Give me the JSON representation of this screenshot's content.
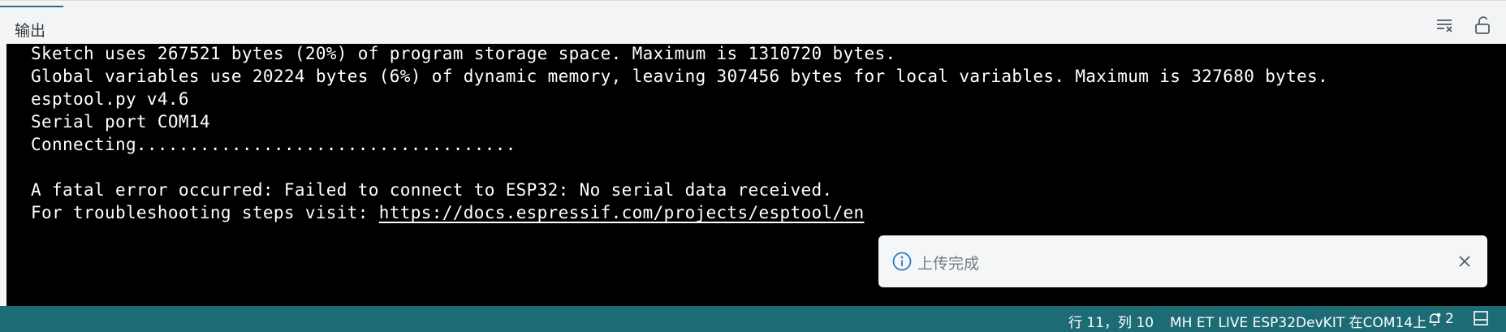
{
  "panel": {
    "tab_label": "输出",
    "clear_icon": "clear-output-icon",
    "lock_icon": "unlock-icon"
  },
  "output": {
    "lines": [
      "Sketch uses 267521 bytes (20%) of program storage space. Maximum is 1310720 bytes.",
      "Global variables use 20224 bytes (6%) of dynamic memory, leaving 307456 bytes for local variables. Maximum is 327680 bytes.",
      "esptool.py v4.6",
      "Serial port COM14",
      "Connecting....................................",
      "",
      "A fatal error occurred: Failed to connect to ESP32: No serial data received."
    ],
    "troubleshoot_prefix": "For troubleshooting steps visit: ",
    "troubleshoot_link": "https://docs.espressif.com/projects/esptool/en"
  },
  "toast": {
    "icon": "info-icon",
    "message": "上传完成",
    "close_icon": "close-icon"
  },
  "status_bar": {
    "position": "行 11，列 10",
    "board": "MH ET LIVE ESP32DevKIT 在COM14上",
    "notifications_count": "2",
    "notifications_icon": "bell-icon",
    "panel_icon": "toggle-panel-icon",
    "background_color": "#1d6b74"
  }
}
